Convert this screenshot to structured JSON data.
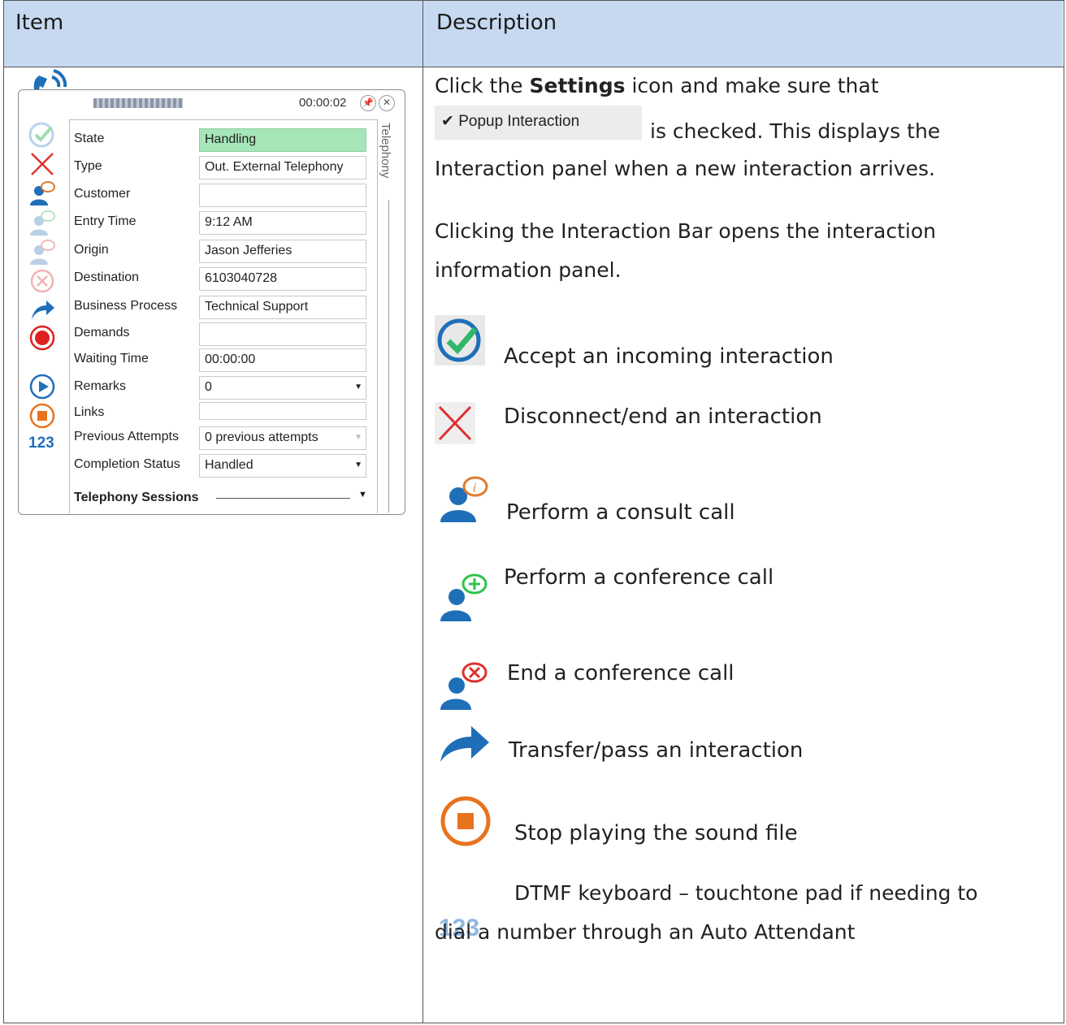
{
  "table": {
    "header_item": "Item",
    "header_description": "Description"
  },
  "panel": {
    "timer": "00:00:02",
    "side_tab": "Telephony",
    "fields": [
      {
        "label": "State",
        "value": "Handling"
      },
      {
        "label": "Type",
        "value": "Out. External Telephony"
      },
      {
        "label": "Customer",
        "value": ""
      },
      {
        "label": "Entry Time",
        "value": "9:12 AM"
      },
      {
        "label": "Origin",
        "value": "Jason Jefferies"
      },
      {
        "label": "Destination",
        "value": "6103040728"
      },
      {
        "label": "Business Process",
        "value": "Technical Support"
      },
      {
        "label": "Demands",
        "value": ""
      },
      {
        "label": "Waiting Time",
        "value": "00:00:00"
      },
      {
        "label": "Remarks",
        "value": "0"
      },
      {
        "label": "Links",
        "value": ""
      },
      {
        "label": "Previous Attempts",
        "value": "0 previous attempts"
      },
      {
        "label": "Completion Status",
        "value": "Handled"
      }
    ],
    "sessions_label": "Telephony Sessions",
    "dtmf_icon_text": "123"
  },
  "description": {
    "p1_a": "Click the ",
    "p1_bold": "Settings",
    "p1_b": " icon and make sure that",
    "popup_chip": "✔ Popup Interaction",
    "p1_c": "is checked. This displays the",
    "p1_d": "Interaction panel when a new interaction arrives.",
    "p2_a": "Clicking the Interaction Bar opens the interaction",
    "p2_b": "information panel.",
    "accept": "Accept an incoming interaction",
    "disconnect": "Disconnect/end an interaction",
    "consult": "Perform a consult call",
    "conference": "Perform a conference call",
    "end_conference": "End a conference call",
    "transfer": "Transfer/pass an interaction",
    "stop": "Stop playing the sound file",
    "dtmf_a": "DTMF keyboard – touchtone pad if needing to",
    "dtmf_b": "dial a number through an Auto Attendant",
    "dtmf_icon_text": "123"
  }
}
